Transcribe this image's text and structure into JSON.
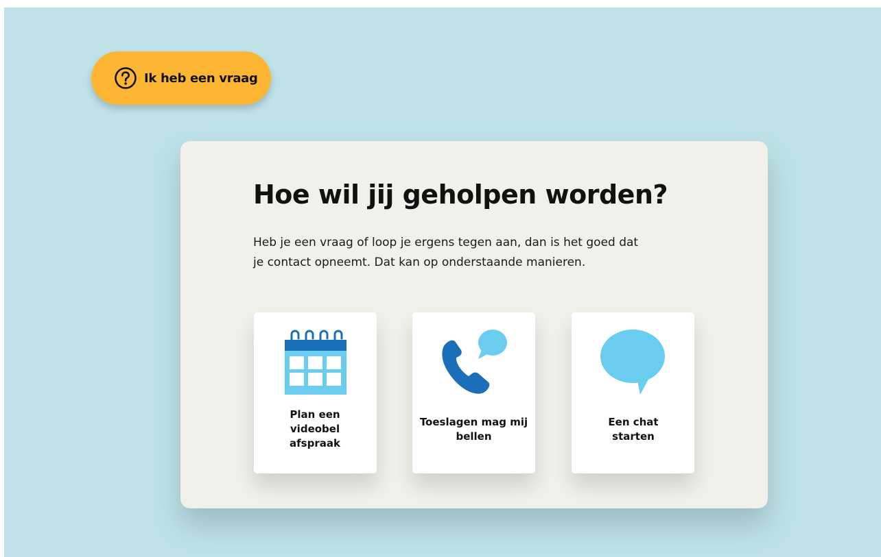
{
  "help_button": {
    "label": "Ik heb een vraag",
    "icon": "question-circle-icon"
  },
  "card": {
    "title": "Hoe wil jij geholpen worden?",
    "text": "Heb je een vraag of loop je ergens tegen aan, dan is het goed dat je contact opneemt. Dat kan op onderstaande manieren."
  },
  "options": [
    {
      "label": "Plan een videobel afspraak",
      "icon": "calendar-icon"
    },
    {
      "label": "Toeslagen mag mij bellen",
      "icon": "phone-call-icon"
    },
    {
      "label": "Een chat starten",
      "icon": "chat-bubble-icon"
    }
  ],
  "colors": {
    "background": "#bee2e8",
    "button": "#fdb634",
    "card": "#f2f0ea",
    "icon_dark_blue": "#1a6fb8",
    "icon_light_blue": "#6acdf0"
  }
}
